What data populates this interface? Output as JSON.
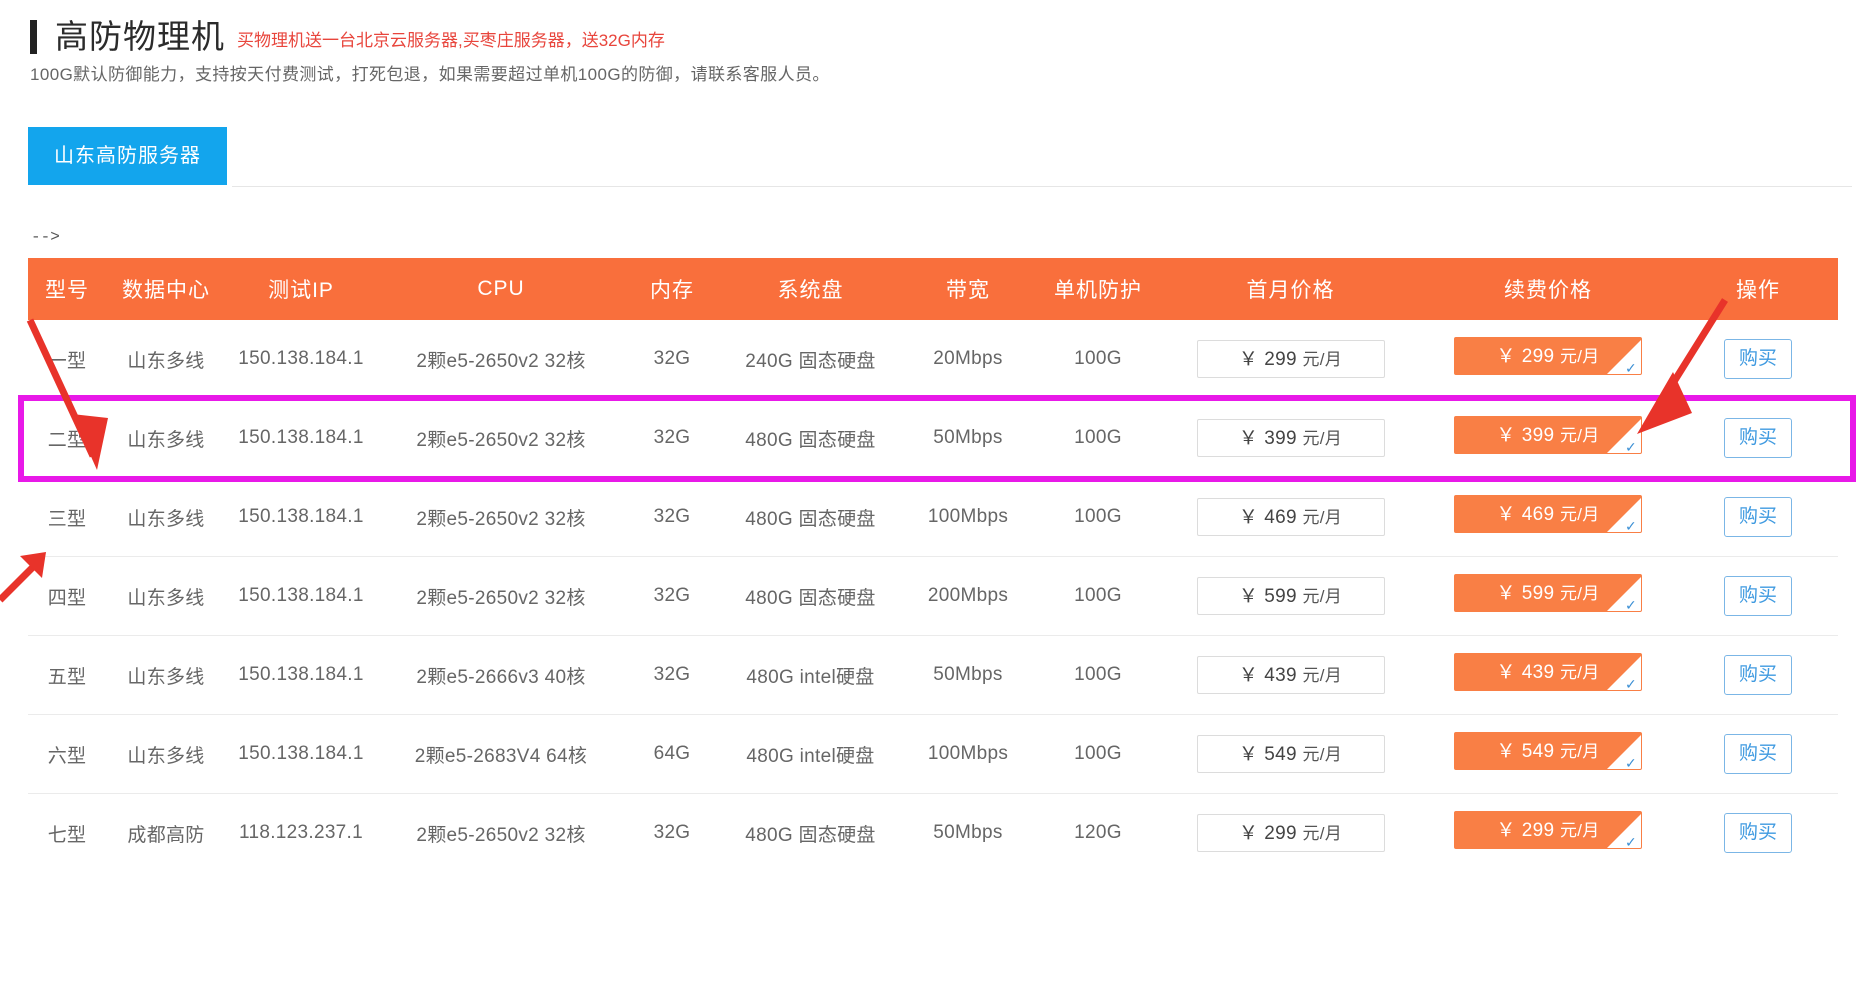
{
  "header": {
    "title": "高防物理机",
    "promo": "买物理机送一台北京云服务器,买枣庄服务器，送32G内存",
    "subtitle": "100G默认防御能力，支持按天付费测试，打死包退，如果需要超过单机100G的防御，请联系客服人员。"
  },
  "tabs": [
    {
      "label": "山东高防服务器",
      "active": true
    }
  ],
  "comment_marker": "-->",
  "table": {
    "columns": [
      "型号",
      "数据中心",
      "测试IP",
      "CPU",
      "内存",
      "系统盘",
      "带宽",
      "单机防护",
      "首月价格",
      "续费价格",
      "操作"
    ],
    "currency_symbol": "￥",
    "price_unit": "元/月",
    "buy_label": "购买",
    "rows": [
      {
        "model": "一型",
        "datacenter": "山东多线",
        "test_ip": "150.138.184.1",
        "cpu": "2颗e5-2650v2 32核",
        "memory": "32G",
        "disk": "240G 固态硬盘",
        "bandwidth": "20Mbps",
        "defense": "100G",
        "first_price": "299",
        "renew_price": "299",
        "highlighted": false
      },
      {
        "model": "二型",
        "datacenter": "山东多线",
        "test_ip": "150.138.184.1",
        "cpu": "2颗e5-2650v2 32核",
        "memory": "32G",
        "disk": "480G 固态硬盘",
        "bandwidth": "50Mbps",
        "defense": "100G",
        "first_price": "399",
        "renew_price": "399",
        "highlighted": true
      },
      {
        "model": "三型",
        "datacenter": "山东多线",
        "test_ip": "150.138.184.1",
        "cpu": "2颗e5-2650v2 32核",
        "memory": "32G",
        "disk": "480G 固态硬盘",
        "bandwidth": "100Mbps",
        "defense": "100G",
        "first_price": "469",
        "renew_price": "469",
        "highlighted": false
      },
      {
        "model": "四型",
        "datacenter": "山东多线",
        "test_ip": "150.138.184.1",
        "cpu": "2颗e5-2650v2 32核",
        "memory": "32G",
        "disk": "480G 固态硬盘",
        "bandwidth": "200Mbps",
        "defense": "100G",
        "first_price": "599",
        "renew_price": "599",
        "highlighted": false
      },
      {
        "model": "五型",
        "datacenter": "山东多线",
        "test_ip": "150.138.184.1",
        "cpu": "2颗e5-2666v3 40核",
        "memory": "32G",
        "disk": "480G intel硬盘",
        "bandwidth": "50Mbps",
        "defense": "100G",
        "first_price": "439",
        "renew_price": "439",
        "highlighted": false
      },
      {
        "model": "六型",
        "datacenter": "山东多线",
        "test_ip": "150.138.184.1",
        "cpu": "2颗e5-2683V4 64核",
        "memory": "64G",
        "disk": "480G intel硬盘",
        "bandwidth": "100Mbps",
        "defense": "100G",
        "first_price": "549",
        "renew_price": "549",
        "highlighted": false
      },
      {
        "model": "七型",
        "datacenter": "成都高防",
        "test_ip": "118.123.237.1",
        "cpu": "2颗e5-2650v2 32核",
        "memory": "32G",
        "disk": "480G 固态硬盘",
        "bandwidth": "50Mbps",
        "defense": "120G",
        "first_price": "299",
        "renew_price": "299",
        "highlighted": false
      }
    ]
  },
  "colors": {
    "header_orange": "#f96f3c",
    "tab_blue": "#13a5ed",
    "promo_red": "#e8453c",
    "renew_orange": "#f97f45",
    "annotation_magenta": "#e819e8",
    "annotation_red": "#e8332a",
    "buy_blue": "#3f9ae0"
  },
  "annotations": {
    "highlight_box_label": "二型 row highlight",
    "arrow_count": 3
  }
}
